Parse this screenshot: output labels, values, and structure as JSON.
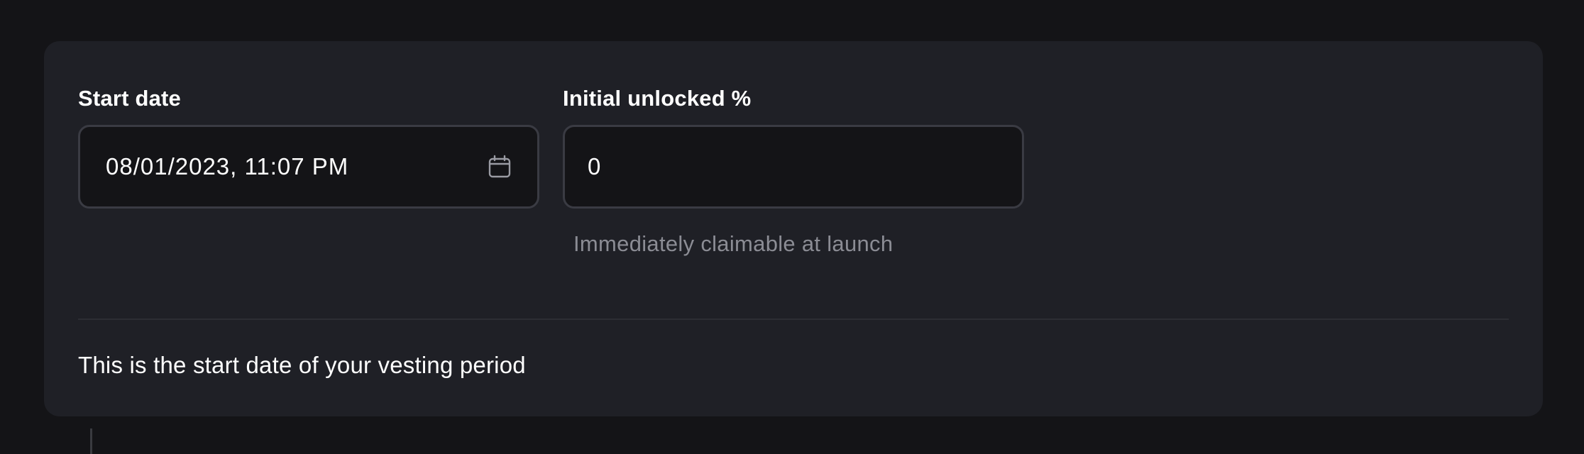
{
  "form": {
    "start_date": {
      "label": "Start date",
      "value": "08/01/2023, 11:07 PM",
      "icon": "calendar-icon"
    },
    "initial_unlocked": {
      "label": "Initial unlocked %",
      "value": "0",
      "helper": "Immediately claimable at launch"
    },
    "description": "This is the start date of your vesting period"
  },
  "colors": {
    "background": "#141417",
    "card": "#1f2026",
    "input_background": "#141417",
    "input_border": "#3a3b43",
    "helper_text": "#8b8c94"
  }
}
